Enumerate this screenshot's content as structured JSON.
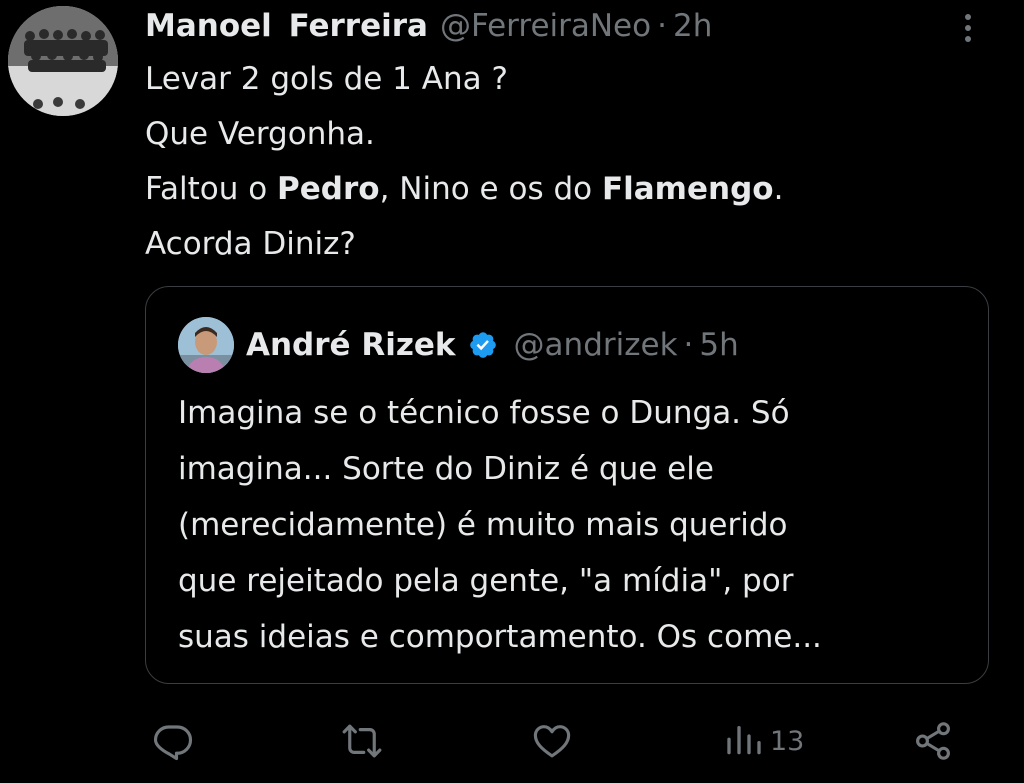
{
  "tweet": {
    "author_name": "Manoel  Ferreira",
    "author_handle": "@FerreiraNeo",
    "separator": "·",
    "time": "2h",
    "lines": [
      [
        "Levar 2 gols de 1 Ana ?"
      ],
      [
        "Que Vergonha."
      ],
      [
        "Faltou o ",
        "Pedro",
        ", Nino e os do ",
        "Flamengo",
        "."
      ],
      [
        "Acorda Diniz?"
      ]
    ],
    "bold_words": [
      "Pedro",
      "Flamengo"
    ]
  },
  "quoted_tweet": {
    "author_name": "André Rizek",
    "verified": true,
    "author_handle": "@andrizek",
    "separator": "·",
    "time": "5h",
    "lines": [
      "Imagina se o técnico fosse o Dunga. Só",
      "imagina... Sorte do Diniz é que ele",
      "(merecidamente) é muito mais querido",
      "que rejeitado pela gente, \"a mídia\", por",
      "suas ideias e comportamento. Os come..."
    ]
  },
  "actions": {
    "reply_icon": "reply-icon",
    "retweet_icon": "retweet-icon",
    "like_icon": "like-icon",
    "views_icon": "views-icon",
    "views_count": "13",
    "share_icon": "share-icon"
  },
  "colors": {
    "background": "#000000",
    "text": "#e7e9ea",
    "secondary": "#71767b",
    "verified": "#1d9bf0",
    "border": "#3a3d41"
  }
}
